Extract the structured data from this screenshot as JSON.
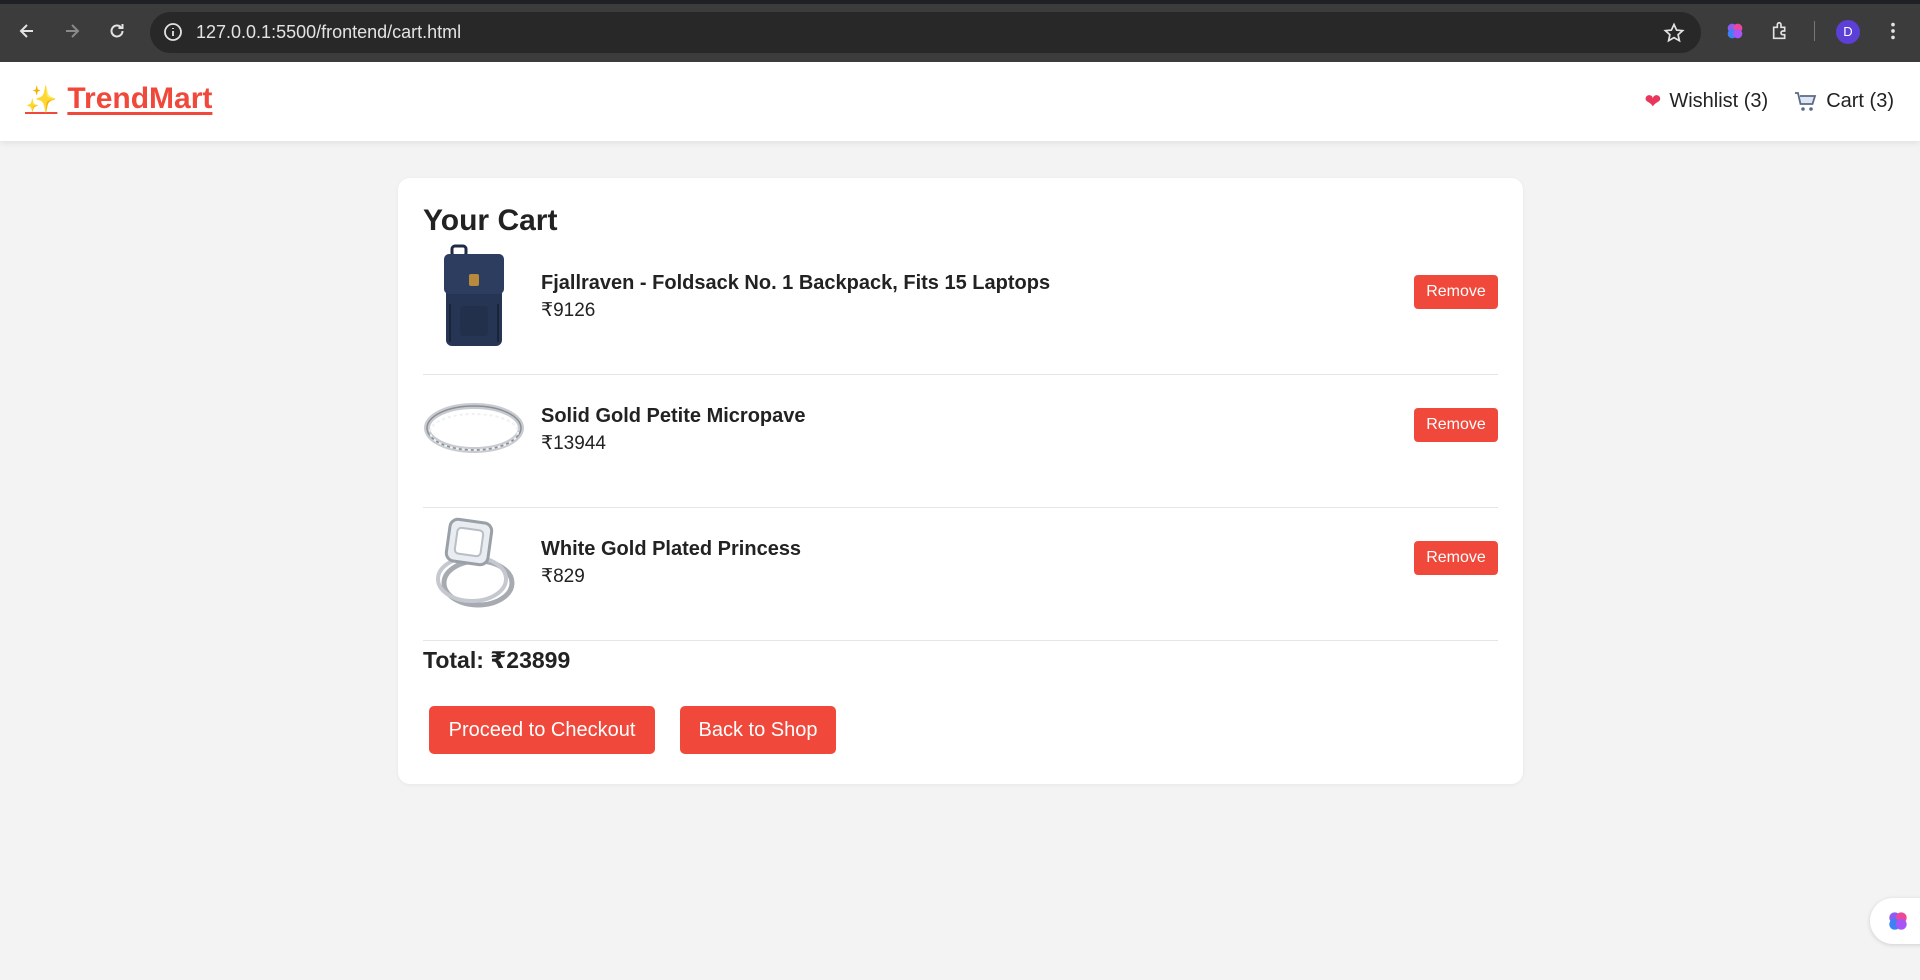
{
  "browser": {
    "url": "127.0.0.1:5500/frontend/cart.html",
    "profile_initial": "D"
  },
  "site": {
    "logo_text": "TrendMart",
    "wishlist_label": "Wishlist (3)",
    "cart_label": "Cart (3)"
  },
  "cart": {
    "title": "Your Cart",
    "items": [
      {
        "name": "Fjallraven - Foldsack No. 1 Backpack, Fits 15 Laptops",
        "price": "₹9126",
        "remove_label": "Remove",
        "image": "backpack"
      },
      {
        "name": "Solid Gold Petite Micropave",
        "price": "₹13944",
        "remove_label": "Remove",
        "image": "ring-band"
      },
      {
        "name": "White Gold Plated Princess",
        "price": "₹829",
        "remove_label": "Remove",
        "image": "engagement-ring"
      }
    ],
    "total": "Total: ₹23899",
    "checkout_label": "Proceed to Checkout",
    "back_label": "Back to Shop"
  },
  "colors": {
    "accent": "#f0483a",
    "page_bg": "#f3f3f3",
    "chrome_bg": "#3c3c3c"
  }
}
